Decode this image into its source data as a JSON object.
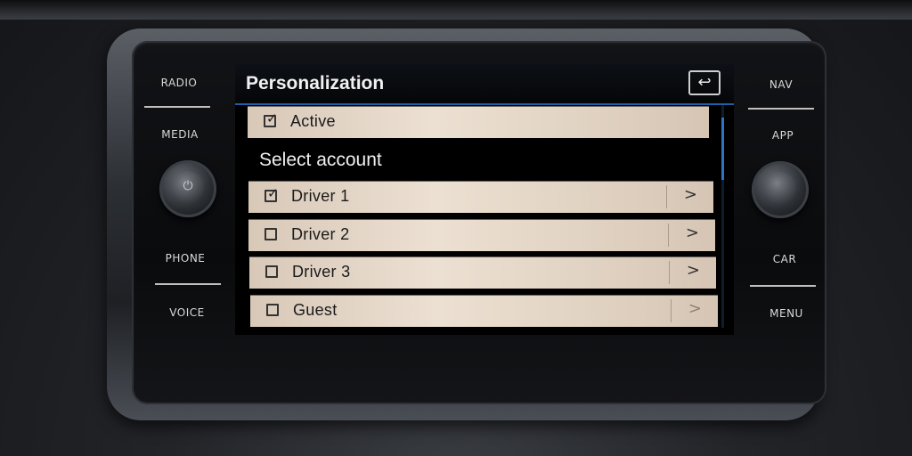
{
  "hardware": {
    "left_buttons": [
      "RADIO",
      "MEDIA",
      "PHONE",
      "VOICE"
    ],
    "right_buttons": [
      "NAV",
      "APP",
      "CAR",
      "MENU"
    ]
  },
  "header": {
    "title": "Personalization",
    "back_icon": "back-arrow-icon"
  },
  "active_row": {
    "label": "Active",
    "checked": true
  },
  "section_title": "Select account",
  "accounts": [
    {
      "label": "Driver 1",
      "checked": true,
      "arrow": ">"
    },
    {
      "label": "Driver 2",
      "checked": false,
      "arrow": ">"
    },
    {
      "label": "Driver 3",
      "checked": false,
      "arrow": ">"
    },
    {
      "label": "Guest",
      "checked": false,
      "arrow": ">"
    }
  ],
  "colors": {
    "accent": "#2d73c6",
    "row_bg": "#e8dccf",
    "screen_bg": "#000000"
  }
}
